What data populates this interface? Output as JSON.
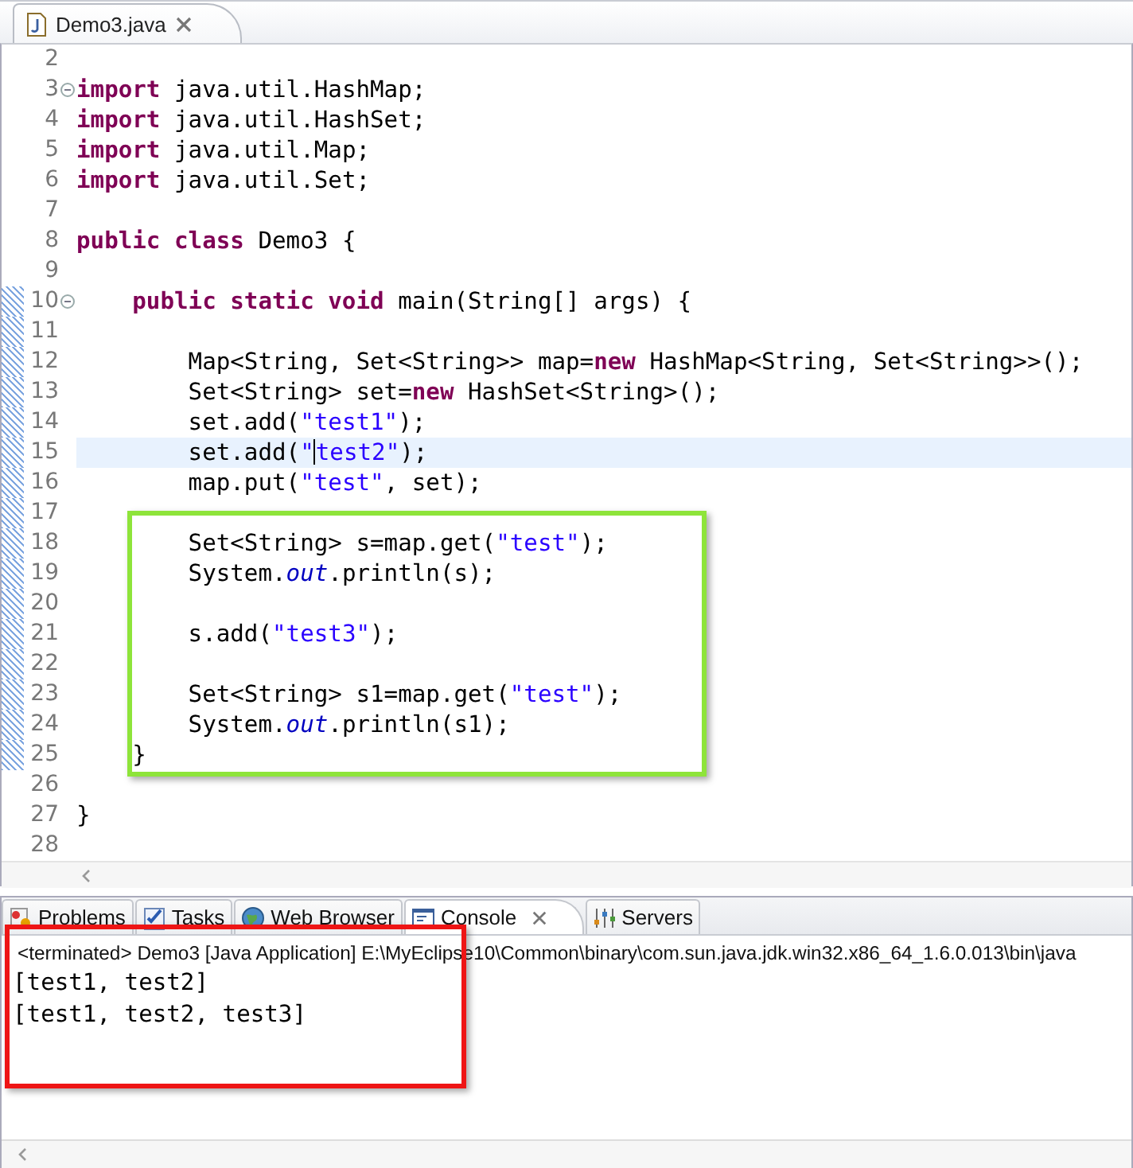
{
  "editor": {
    "tab": {
      "title": "Demo3.java"
    },
    "lines": [
      {
        "number": "2"
      },
      {
        "number": "3",
        "fold": true,
        "tokens": [
          {
            "kind": "keyword",
            "text": "import"
          },
          {
            "kind": "plain",
            "text": " java.util.HashMap;"
          }
        ]
      },
      {
        "number": "4",
        "tokens": [
          {
            "kind": "keyword",
            "text": "import"
          },
          {
            "kind": "plain",
            "text": " java.util.HashSet;"
          }
        ]
      },
      {
        "number": "5",
        "tokens": [
          {
            "kind": "keyword",
            "text": "import"
          },
          {
            "kind": "plain",
            "text": " java.util.Map;"
          }
        ]
      },
      {
        "number": "6",
        "tokens": [
          {
            "kind": "keyword",
            "text": "import"
          },
          {
            "kind": "plain",
            "text": " java.util.Set;"
          }
        ]
      },
      {
        "number": "7"
      },
      {
        "number": "8",
        "tokens": [
          {
            "kind": "keyword",
            "text": "public class"
          },
          {
            "kind": "plain",
            "text": " Demo3 {"
          }
        ]
      },
      {
        "number": "9"
      },
      {
        "number": "10",
        "fold": true,
        "changed": true,
        "tokens": [
          {
            "kind": "keyword",
            "text": "    public static void"
          },
          {
            "kind": "plain",
            "text": " main(String[] args) {"
          }
        ]
      },
      {
        "number": "11",
        "changed": true
      },
      {
        "number": "12",
        "changed": true,
        "tokens": [
          {
            "kind": "plain",
            "text": "        Map<String, Set<String>> map="
          },
          {
            "kind": "keyword",
            "text": "new"
          },
          {
            "kind": "plain",
            "text": " HashMap<String, Set<String>>();"
          }
        ]
      },
      {
        "number": "13",
        "changed": true,
        "tokens": [
          {
            "kind": "plain",
            "text": "        Set<String> set="
          },
          {
            "kind": "keyword",
            "text": "new"
          },
          {
            "kind": "plain",
            "text": " HashSet<String>();"
          }
        ]
      },
      {
        "number": "14",
        "changed": true,
        "tokens": [
          {
            "kind": "plain",
            "text": "        set.add("
          },
          {
            "kind": "string",
            "text": "\"test1\""
          },
          {
            "kind": "plain",
            "text": ");"
          }
        ]
      },
      {
        "number": "15",
        "changed": true,
        "current": true,
        "tokens": [
          {
            "kind": "plain",
            "text": "        set.add("
          },
          {
            "kind": "string",
            "text": "\""
          },
          {
            "kind": "string",
            "text": "test2\"",
            "caret_before": true
          },
          {
            "kind": "plain",
            "text": ");"
          }
        ]
      },
      {
        "number": "16",
        "changed": true,
        "tokens": [
          {
            "kind": "plain",
            "text": "        map.put("
          },
          {
            "kind": "string",
            "text": "\"test\""
          },
          {
            "kind": "plain",
            "text": ", set);"
          }
        ]
      },
      {
        "number": "17",
        "changed": true
      },
      {
        "number": "18",
        "changed": true,
        "tokens": [
          {
            "kind": "plain",
            "text": "        Set<String> s=map.get("
          },
          {
            "kind": "string",
            "text": "\"test\""
          },
          {
            "kind": "plain",
            "text": ");"
          }
        ]
      },
      {
        "number": "19",
        "changed": true,
        "tokens": [
          {
            "kind": "plain",
            "text": "        System."
          },
          {
            "kind": "field",
            "text": "out"
          },
          {
            "kind": "plain",
            "text": ".println(s);"
          }
        ]
      },
      {
        "number": "20",
        "changed": true
      },
      {
        "number": "21",
        "changed": true,
        "tokens": [
          {
            "kind": "plain",
            "text": "        s.add("
          },
          {
            "kind": "string",
            "text": "\"test3\""
          },
          {
            "kind": "plain",
            "text": ");"
          }
        ]
      },
      {
        "number": "22",
        "changed": true
      },
      {
        "number": "23",
        "changed": true,
        "tokens": [
          {
            "kind": "plain",
            "text": "        Set<String> s1=map.get("
          },
          {
            "kind": "string",
            "text": "\"test\""
          },
          {
            "kind": "plain",
            "text": ");"
          }
        ]
      },
      {
        "number": "24",
        "changed": true,
        "tokens": [
          {
            "kind": "plain",
            "text": "        System."
          },
          {
            "kind": "field",
            "text": "out"
          },
          {
            "kind": "plain",
            "text": ".println(s1);"
          }
        ]
      },
      {
        "number": "25",
        "changed": true,
        "tokens": [
          {
            "kind": "plain",
            "text": "    }"
          }
        ]
      },
      {
        "number": "26"
      },
      {
        "number": "27",
        "tokens": [
          {
            "kind": "plain",
            "text": "}"
          }
        ]
      },
      {
        "number": "28"
      }
    ]
  },
  "panel": {
    "tabs": [
      {
        "label": "Problems",
        "selected": false
      },
      {
        "label": "Tasks",
        "selected": false
      },
      {
        "label": "Web Browser",
        "selected": false
      },
      {
        "label": "Console",
        "selected": true
      },
      {
        "label": "Servers",
        "selected": false
      }
    ],
    "console": {
      "header": "<terminated> Demo3 [Java Application] E:\\MyEclipse10\\Common\\binary\\com.sun.java.jdk.win32.x86_64_1.6.0.013\\bin\\java",
      "output": [
        "[test1, test2]",
        "[test1, test2, test3]"
      ]
    }
  }
}
